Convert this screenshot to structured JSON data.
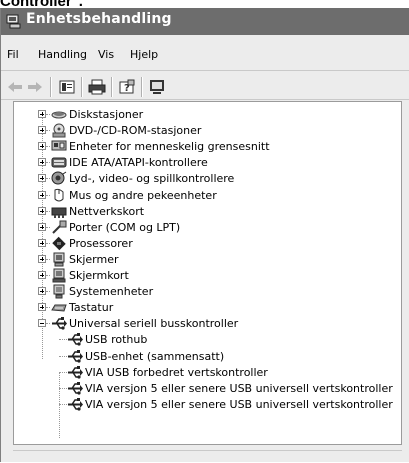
{
  "caption": "Controller\".",
  "window": {
    "title": "Enhetsbehandling"
  },
  "menu": [
    {
      "label": "Fil",
      "name": "menu-fil"
    },
    {
      "label": "Handling",
      "name": "menu-handling"
    },
    {
      "label": "Vis",
      "name": "menu-vis"
    },
    {
      "label": "Hjelp",
      "name": "menu-hjelp"
    }
  ],
  "toolbar": {
    "buttons": [
      "back-arrow-icon",
      "forward-arrow-icon",
      "properties-icon",
      "print-icon",
      "help-icon",
      "computer-icon"
    ]
  },
  "tree": {
    "categories": [
      {
        "label": "Diskstasjoner",
        "icon": "disk-drive-icon",
        "expanded": false
      },
      {
        "label": "DVD-/CD-ROM-stasjoner",
        "icon": "cdrom-icon",
        "expanded": false
      },
      {
        "label": "Enheter for menneskelig grensesnitt",
        "icon": "hid-icon",
        "expanded": false
      },
      {
        "label": "IDE ATA/ATAPI-kontrollere",
        "icon": "ide-controller-icon",
        "expanded": false
      },
      {
        "label": "Lyd-, video- og spillkontrollere",
        "icon": "sound-icon",
        "expanded": false
      },
      {
        "label": "Mus og andre pekeenheter",
        "icon": "mouse-icon",
        "expanded": false
      },
      {
        "label": "Nettverkskort",
        "icon": "network-card-icon",
        "expanded": false
      },
      {
        "label": "Porter (COM og LPT)",
        "icon": "port-icon",
        "expanded": false
      },
      {
        "label": "Prosessorer",
        "icon": "processor-icon",
        "expanded": false
      },
      {
        "label": "Skjermer",
        "icon": "monitor-icon",
        "expanded": false
      },
      {
        "label": "Skjermkort",
        "icon": "display-adapter-icon",
        "expanded": false
      },
      {
        "label": "Systemenheter",
        "icon": "system-device-icon",
        "expanded": false
      },
      {
        "label": "Tastatur",
        "icon": "keyboard-icon",
        "expanded": false
      },
      {
        "label": "Universal seriell busskontroller",
        "icon": "usb-icon",
        "expanded": true
      }
    ],
    "usb_children": [
      "USB rothub",
      "USB-enhet (sammensatt)",
      "VIA USB forbedret vertskontroller",
      "VIA versjon 5 eller senere USB universell vertskontroller",
      "VIA versjon 5 eller senere USB universell vertskontroller"
    ]
  }
}
